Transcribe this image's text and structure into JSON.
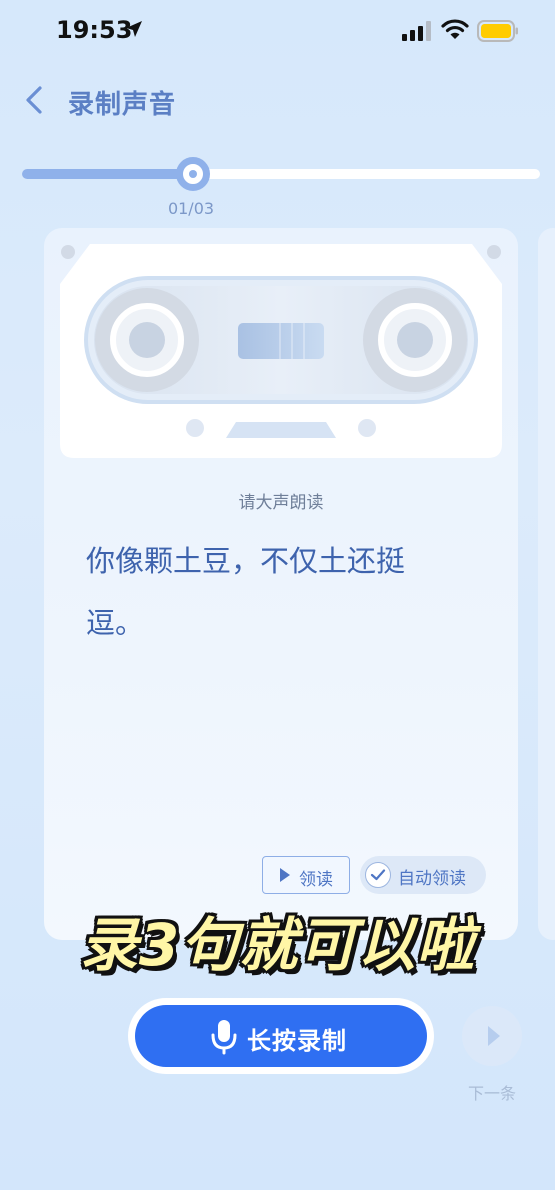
{
  "status_bar": {
    "time": "19:53"
  },
  "nav": {
    "title": "录制声音"
  },
  "progress": {
    "label": "01/03",
    "current": 1,
    "total": 3,
    "fraction": 0.33
  },
  "card": {
    "prompt": "请大声朗读",
    "sentence_line1": "你像颗土豆，不仅土还挺",
    "sentence_line2": "逗。",
    "read_button": "领读",
    "auto_read": "自动领读",
    "auto_read_checked": true
  },
  "caption": "录3句就可以啦",
  "record": {
    "label": "长按录制"
  },
  "next": {
    "label": "下一条"
  },
  "colors": {
    "accent": "#2f6ff2",
    "progress": "#8fb1ea",
    "caption": "#fff6a6",
    "title": "#5b7fc4"
  }
}
